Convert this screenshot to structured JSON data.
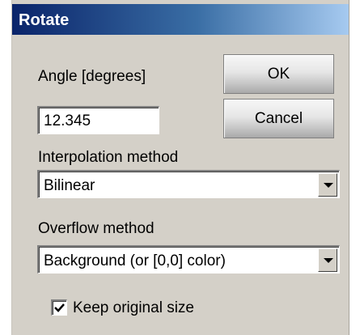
{
  "window": {
    "title": "Rotate"
  },
  "angle": {
    "label": "Angle [degrees]",
    "value": "12.345"
  },
  "buttons": {
    "ok": "OK",
    "cancel": "Cancel"
  },
  "interpolation": {
    "label": "Interpolation method",
    "selected": "Bilinear"
  },
  "overflow": {
    "label": "Overflow method",
    "selected": "Background (or [0,0] color)"
  },
  "keep_size": {
    "label": "Keep original size",
    "checked": true
  },
  "icons": {
    "dropdown": "chevron-down-icon",
    "check": "checkmark-icon"
  },
  "colors": {
    "title_bar": "#0a246a",
    "dialog_bg": "#d4d0c8"
  }
}
